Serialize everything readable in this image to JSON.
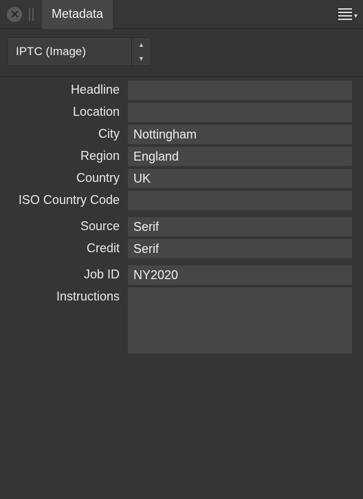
{
  "header": {
    "tab_label": "Metadata"
  },
  "dropdown": {
    "selected": "IPTC (Image)"
  },
  "fields": {
    "headline_label": "Headline",
    "headline_value": "",
    "location_label": "Location",
    "location_value": "",
    "city_label": "City",
    "city_value": "Nottingham",
    "region_label": "Region",
    "region_value": "England",
    "country_label": "Country",
    "country_value": "UK",
    "iso_label": "ISO Country Code",
    "iso_value": "",
    "source_label": "Source",
    "source_value": "Serif",
    "credit_label": "Credit",
    "credit_value": "Serif",
    "jobid_label": "Job ID",
    "jobid_value": "NY2020",
    "instructions_label": "Instructions",
    "instructions_value": ""
  }
}
